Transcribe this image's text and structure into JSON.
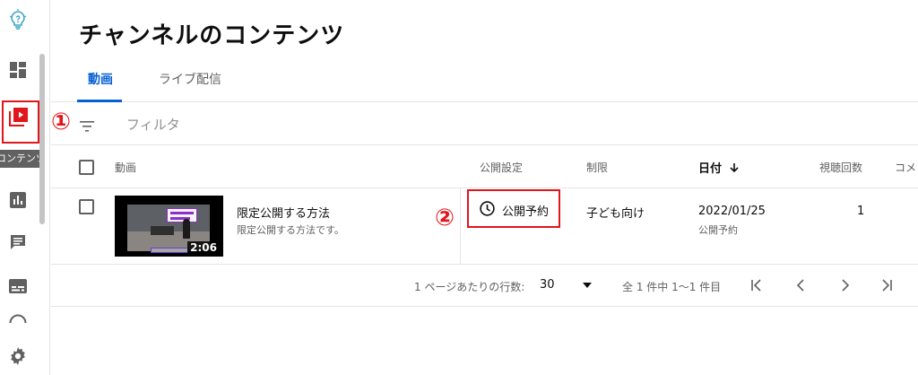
{
  "page": {
    "title": "チャンネルのコンテンツ"
  },
  "sidebar": {
    "items": [
      {
        "icon": "lightbulb-icon"
      },
      {
        "icon": "dashboard-icon"
      },
      {
        "icon": "content-icon",
        "active": true,
        "tooltip": "コンテンツ"
      },
      {
        "icon": "analytics-icon"
      },
      {
        "icon": "comments-icon"
      },
      {
        "icon": "subtitles-icon"
      },
      {
        "icon": "copyright-icon"
      },
      {
        "icon": "settings-icon"
      }
    ]
  },
  "annotations": {
    "marker1": "①",
    "marker2": "②",
    "color": "#e0161b"
  },
  "tabs": [
    {
      "label": "動画",
      "active": true
    },
    {
      "label": "ライブ配信",
      "active": false
    }
  ],
  "filter": {
    "placeholder": "フィルタ"
  },
  "table": {
    "headers": {
      "video": "動画",
      "visibility": "公開設定",
      "restrictions": "制限",
      "date": "日付",
      "views": "視聴回数",
      "comments": "コメ"
    },
    "rows": [
      {
        "title": "限定公開する方法",
        "description": "限定公開する方法です。",
        "duration": "2:06",
        "visibility": "公開予約",
        "restriction": "子ども向け",
        "date": "2022/01/25",
        "date_status": "公開予約",
        "views": "1"
      }
    ]
  },
  "pagination": {
    "rows_per_page_label": "1 ページあたりの行数:",
    "rows_per_page": "30",
    "range_text": "全 1 件中 1〜1 件目"
  },
  "colors": {
    "accent": "#065fd4",
    "annotation": "#e0161b",
    "text": "#0d0d0d",
    "muted": "#606060"
  }
}
